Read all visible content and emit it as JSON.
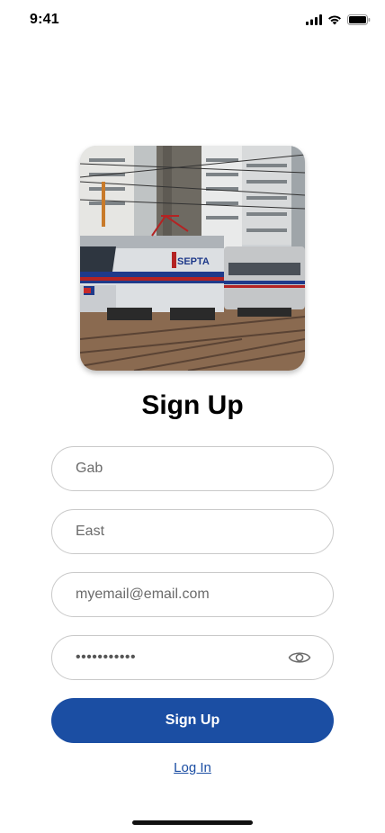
{
  "status_bar": {
    "time": "9:41",
    "icons": [
      "cellular-signal-icon",
      "wifi-icon",
      "battery-icon"
    ]
  },
  "hero_image": {
    "icon": "train-photo",
    "logo_text": "SEPTA"
  },
  "title": "Sign Up",
  "form": {
    "first_name": {
      "value": "Gab",
      "placeholder": "Gab"
    },
    "last_name": {
      "value": "East",
      "placeholder": "East"
    },
    "email": {
      "value": "myemail@email.com",
      "placeholder": "myemail@email.com"
    },
    "password": {
      "masked": "•••••••••••",
      "toggle_icon": "eye-icon"
    }
  },
  "submit_label": "Sign Up",
  "login_link": "Log In",
  "colors": {
    "primary": "#1b4ea3",
    "border": "#c9c9c9",
    "text_muted": "#6b6b6b"
  }
}
